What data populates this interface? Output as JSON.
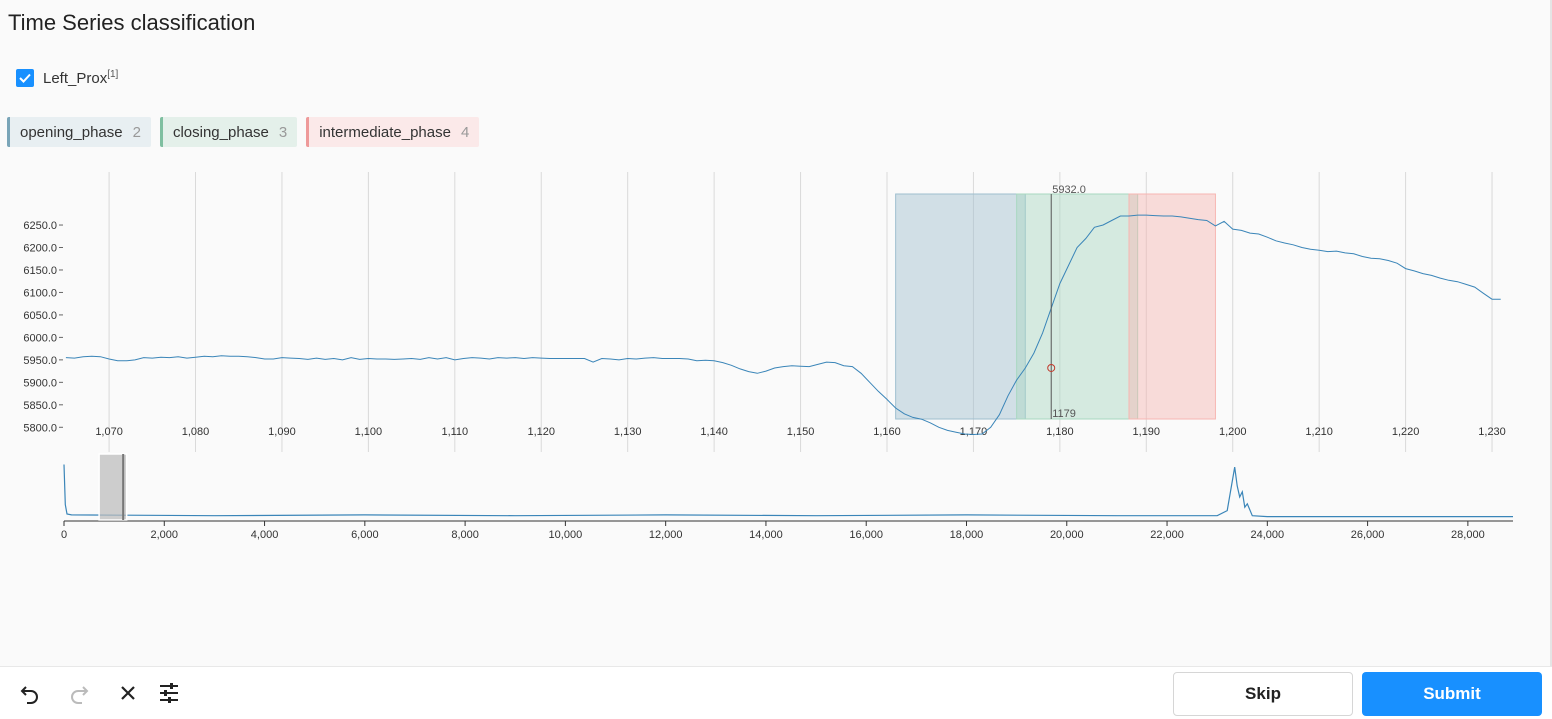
{
  "page": {
    "title": "Time Series classification"
  },
  "channel": {
    "name": "Left_Prox",
    "footnote": "[1]",
    "checked": true
  },
  "labels": [
    {
      "name": "opening_phase",
      "hotkey": "2",
      "color": "#7aa5b8"
    },
    {
      "name": "closing_phase",
      "hotkey": "3",
      "color": "#7fbfa0"
    },
    {
      "name": "intermediate_phase",
      "hotkey": "4",
      "color": "#ee9a9a"
    }
  ],
  "chart_data": {
    "type": "line",
    "main": {
      "series": [
        {
          "x": [
            1065,
            1066,
            1067,
            1068,
            1069,
            1070,
            1071,
            1072,
            1073,
            1074,
            1075,
            1076,
            1077,
            1078,
            1079,
            1080,
            1081,
            1082,
            1083,
            1084,
            1085,
            1086,
            1087,
            1088,
            1089,
            1090,
            1091,
            1092,
            1093,
            1094,
            1095,
            1096,
            1097,
            1098,
            1099,
            1100,
            1101,
            1102,
            1103,
            1104,
            1105,
            1106,
            1107,
            1108,
            1109,
            1110,
            1111,
            1112,
            1113,
            1114,
            1115,
            1116,
            1117,
            1118,
            1119,
            1120,
            1121,
            1122,
            1123,
            1124,
            1125,
            1126,
            1127,
            1128,
            1129,
            1130,
            1131,
            1132,
            1133,
            1134,
            1135,
            1136,
            1137,
            1138,
            1139,
            1140,
            1141,
            1142,
            1143,
            1144,
            1145,
            1146,
            1147,
            1148,
            1149,
            1150,
            1151,
            1152,
            1153,
            1154,
            1155,
            1156,
            1157,
            1158,
            1159,
            1160,
            1161,
            1162,
            1163,
            1164,
            1165,
            1166,
            1167,
            1168,
            1169,
            1170,
            1171,
            1172,
            1173,
            1174,
            1175,
            1176,
            1177,
            1178,
            1179,
            1180,
            1181,
            1182,
            1183,
            1184,
            1185,
            1186,
            1187,
            1188,
            1189,
            1190,
            1191,
            1192,
            1193,
            1194,
            1195,
            1196,
            1197,
            1198,
            1199,
            1200,
            1201,
            1202,
            1203,
            1204,
            1205,
            1206,
            1207,
            1208,
            1209,
            1210,
            1211,
            1212,
            1213,
            1214,
            1215,
            1216,
            1217,
            1218,
            1219,
            1220,
            1221,
            1222,
            1223,
            1224,
            1225,
            1226,
            1227,
            1228,
            1229,
            1230,
            1231
          ],
          "y": [
            5955,
            5954,
            5957,
            5958,
            5957,
            5952,
            5948,
            5948,
            5950,
            5955,
            5954,
            5956,
            5955,
            5957,
            5954,
            5956,
            5958,
            5957,
            5959,
            5958,
            5958,
            5957,
            5955,
            5952,
            5952,
            5955,
            5954,
            5953,
            5951,
            5954,
            5951,
            5953,
            5950,
            5955,
            5951,
            5953,
            5952,
            5952,
            5951,
            5952,
            5953,
            5951,
            5955,
            5952,
            5955,
            5950,
            5953,
            5955,
            5954,
            5952,
            5955,
            5954,
            5955,
            5953,
            5955,
            5954,
            5953,
            5953,
            5953,
            5953,
            5953,
            5945,
            5953,
            5952,
            5950,
            5953,
            5952,
            5954,
            5955,
            5953,
            5953,
            5953,
            5952,
            5948,
            5949,
            5948,
            5944,
            5938,
            5930,
            5924,
            5920,
            5925,
            5932,
            5935,
            5937,
            5936,
            5935,
            5940,
            5945,
            5944,
            5937,
            5935,
            5920,
            5900,
            5880,
            5862,
            5843,
            5830,
            5822,
            5818,
            5810,
            5800,
            5793,
            5789,
            5785,
            5784,
            5785,
            5800,
            5828,
            5870,
            5905,
            5932,
            5965,
            6010,
            6065,
            6120,
            6160,
            6200,
            6220,
            6245,
            6250,
            6260,
            6270,
            6270,
            6272,
            6272,
            6271,
            6270,
            6270,
            6268,
            6265,
            6262,
            6260,
            6248,
            6258,
            6241,
            6238,
            6232,
            6230,
            6223,
            6215,
            6210,
            6206,
            6200,
            6196,
            6194,
            6191,
            6192,
            6188,
            6186,
            6180,
            6176,
            6175,
            6171,
            6165,
            6153,
            6148,
            6142,
            6138,
            6132,
            6127,
            6124,
            6118,
            6112,
            6098,
            6085,
            6085
          ],
          "line_color": "#3a85b8"
        }
      ],
      "x_ticks": [
        "1,070",
        "1,080",
        "1,090",
        "1,100",
        "1,110",
        "1,120",
        "1,130",
        "1,140",
        "1,150",
        "1,160",
        "1,170",
        "1,180",
        "1,190",
        "1,200",
        "1,210",
        "1,220",
        "1,230"
      ],
      "x_tick_values": [
        1070,
        1080,
        1090,
        1100,
        1110,
        1120,
        1130,
        1140,
        1150,
        1160,
        1170,
        1180,
        1190,
        1200,
        1210,
        1220,
        1230
      ],
      "y_ticks": [
        "6250.0",
        "6200.0",
        "6150.0",
        "6100.0",
        "6050.0",
        "6000.0",
        "5950.0",
        "5900.0",
        "5850.0",
        "5800.0"
      ],
      "y_tick_values": [
        6250,
        6200,
        6150,
        6100,
        6050,
        6000,
        5950,
        5900,
        5850,
        5800
      ],
      "xlim": [
        1064.9,
        1231.5
      ],
      "ylim": [
        5745,
        6368
      ],
      "grid": "vertical",
      "regions": [
        {
          "label": "opening_phase",
          "x0": 1161,
          "x1": 1176,
          "color": "#9fbfcf"
        },
        {
          "label": "closing_phase",
          "x0": 1175,
          "x1": 1189,
          "color": "#a8d8c0"
        },
        {
          "label": "intermediate_phase",
          "x0": 1188,
          "x1": 1198,
          "color": "#f7b6b2"
        }
      ],
      "cursor": {
        "x": 1179,
        "y": 5932.0,
        "x_label": "1179",
        "y_label": "5932.0"
      }
    },
    "overview": {
      "x_ticks": [
        "0",
        "2,000",
        "4,000",
        "6,000",
        "8,000",
        "10,000",
        "12,000",
        "14,000",
        "16,000",
        "18,000",
        "20,000",
        "22,000",
        "24,000",
        "26,000",
        "28,000"
      ],
      "x_tick_values": [
        0,
        2000,
        4000,
        6000,
        8000,
        10000,
        12000,
        14000,
        16000,
        18000,
        20000,
        22000,
        24000,
        26000,
        28000
      ],
      "xlim": [
        0,
        28900
      ],
      "brush": [
        700,
        1250
      ],
      "brush_handle": 1180,
      "series": [
        {
          "x": [
            0,
            25,
            60,
            150,
            3000,
            6000,
            9000,
            12000,
            15000,
            18000,
            21000,
            23000,
            23200,
            23300,
            23350,
            23400,
            23450,
            23500,
            23550,
            23600,
            23700,
            24000,
            26000,
            28000,
            28900
          ],
          "y": [
            6,
            1.3,
            0.2,
            0.1,
            0.0,
            0.1,
            0.0,
            0.1,
            0.0,
            0.1,
            0.0,
            0.0,
            0.6,
            4.0,
            5.7,
            3.5,
            2.2,
            2.8,
            1.0,
            1.4,
            0.0,
            -0.1,
            -0.1,
            -0.1,
            -0.1
          ]
        }
      ],
      "ylim": [
        -0.5,
        7
      ]
    }
  },
  "footer": {
    "undo_icon": "undo-icon",
    "redo_icon": "redo-icon",
    "reset_icon": "close-icon",
    "settings_icon": "settings-sliders-icon",
    "skip_label": "Skip",
    "submit_label": "Submit",
    "accent": "#1890ff"
  }
}
